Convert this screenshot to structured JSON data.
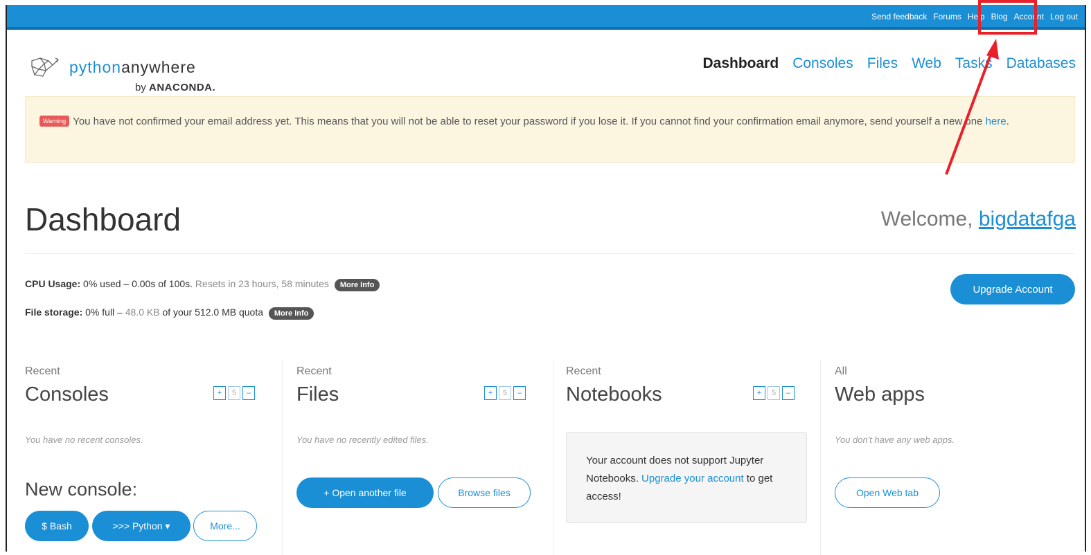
{
  "topnav": [
    "Send feedback",
    "Forums",
    "Help",
    "Blog",
    "Account",
    "Log out"
  ],
  "logo": {
    "name_prefix": "python",
    "name_suffix": "anywhere",
    "by": "by",
    "company": "ANACONDA."
  },
  "mainnav": [
    "Dashboard",
    "Consoles",
    "Files",
    "Web",
    "Tasks",
    "Databases"
  ],
  "warning": {
    "badge": "Warning",
    "text": "You have not confirmed your email address yet. This means that you will not be able to reset your password if you lose it. If you cannot find your confirmation email anymore, send yourself a new one ",
    "link": "here",
    "end": "."
  },
  "page": {
    "title": "Dashboard",
    "welcome": "Welcome, ",
    "username": "bigdatafga"
  },
  "usage": {
    "cpu_label": "CPU Usage:",
    "cpu_value": " 0% used – 0.00s of 100s.",
    "cpu_reset": " Resets in 23 hours, 58 minutes",
    "storage_label": "File storage:",
    "storage_value": " 0% full – ",
    "storage_used": "48.0 KB",
    "storage_quota": " of your 512.0 MB quota",
    "more_info": "More Info",
    "upgrade": "Upgrade Account"
  },
  "stepper": {
    "plus": "+",
    "count": "5",
    "minus": "–"
  },
  "consoles": {
    "small": "Recent",
    "big": "Consoles",
    "empty": "You have no recent consoles.",
    "new_label": "New console:",
    "bash": "$ Bash",
    "python": ">>> Python ▾",
    "more": "More..."
  },
  "files": {
    "small": "Recent",
    "big": "Files",
    "empty": "You have no recently edited files.",
    "open": "+ Open another file",
    "browse": "Browse files"
  },
  "notebooks": {
    "small": "Recent",
    "big": "Notebooks",
    "text": "Your account does not support Jupyter Notebooks. ",
    "link": "Upgrade your account",
    "end": " to get access!"
  },
  "webapps": {
    "small": "All",
    "big": "Web apps",
    "empty": "You don't have any web apps.",
    "open": "Open Web tab"
  },
  "colors": {
    "brand": "#1b8fd6",
    "warning_bg": "#fcf6e1",
    "annotation": "#e8202a"
  }
}
